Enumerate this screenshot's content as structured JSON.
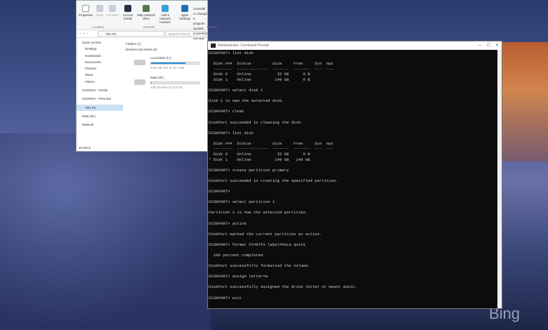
{
  "explorer": {
    "ribbon_buttons": [
      "Properties",
      "Open",
      "Rename",
      "Access media",
      "Map network drive",
      "Add a network location",
      "Open Settings"
    ],
    "groups": [
      "Location",
      "Network",
      "System"
    ],
    "system_links": [
      "Uninstall or change a program",
      "System properties",
      "Manage"
    ],
    "address": "This PC",
    "search_placeholder": "Search This PC",
    "nav": [
      "Quick access",
      "Desktop",
      "Downloads",
      "Documents",
      "Pictures",
      "Music",
      "Videos",
      "OneDrive - Family",
      "OneDrive - Personal",
      "This PC",
      "Data (W:)",
      "Network"
    ],
    "folders_header": "Folders (7)",
    "devices_header": "Devices and drives (2)",
    "drives": [
      {
        "name": "Local Disk (C:)",
        "free": "9.54 GB free of 34.4 GB",
        "used_pct": 72
      },
      {
        "name": "Data (W:)",
        "free": "149 GB free of 149 GB",
        "used_pct": 1
      }
    ],
    "status": "10 items"
  },
  "cmd": {
    "title": "Administrator: Command Prompt",
    "lines": [
      "DISKPART> list disk",
      "",
      "  Disk ###  Status         Size     Free     Dyn  Gpt",
      "  --------  -------------  -------  -------  ---  ---",
      "  Disk 0    Online           35 GB      0 B",
      "  Disk 1    Online          149 GB      0 B",
      "",
      "DISKPART> select disk 1",
      "",
      "Disk 1 is now the selected disk.",
      "",
      "DISKPART> clean",
      "",
      "DiskPart succeeded in cleaning the disk.",
      "",
      "DISKPART> list disk",
      "",
      "  Disk ###  Status         Size     Free     Dyn  Gpt",
      "  --------  -------------  -------  -------  ---  ---",
      "  Disk 0    Online           35 GB      0 B",
      "* Disk 1    Online          149 GB   149 GB",
      "",
      "DISKPART> create partition primary",
      "",
      "DiskPart succeeded in creating the specified partition.",
      "",
      "DISKPART>",
      "",
      "DISKPART> select partition 1",
      "",
      "Partition 1 is now the selected partition.",
      "",
      "DISKPART> active",
      "",
      "DiskPart marked the current partition as active.",
      "",
      "DISKPART> format FS=NTFS label=Data quick",
      "",
      "  100 percent completed",
      "",
      "DiskPart successfully formatted the volume.",
      "",
      "DISKPART> assign letter=w",
      "",
      "DiskPart successfully assigned the drive letter or mount point.",
      "",
      "DISKPART> exit"
    ]
  },
  "watermark": "Bing"
}
